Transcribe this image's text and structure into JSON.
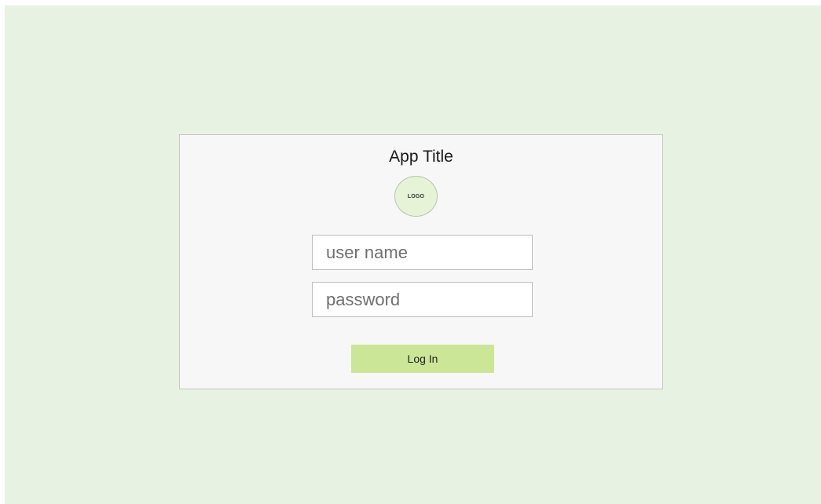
{
  "app": {
    "title": "App Title",
    "logo_text": "LOGO"
  },
  "login_form": {
    "username_placeholder": "user name",
    "username_value": "",
    "password_placeholder": "password",
    "password_value": "",
    "submit_label": "Log In"
  },
  "colors": {
    "background": "#e8f2e2",
    "card": "#f7f7f7",
    "logo_fill": "#e6f3d6",
    "button": "#cce697"
  }
}
